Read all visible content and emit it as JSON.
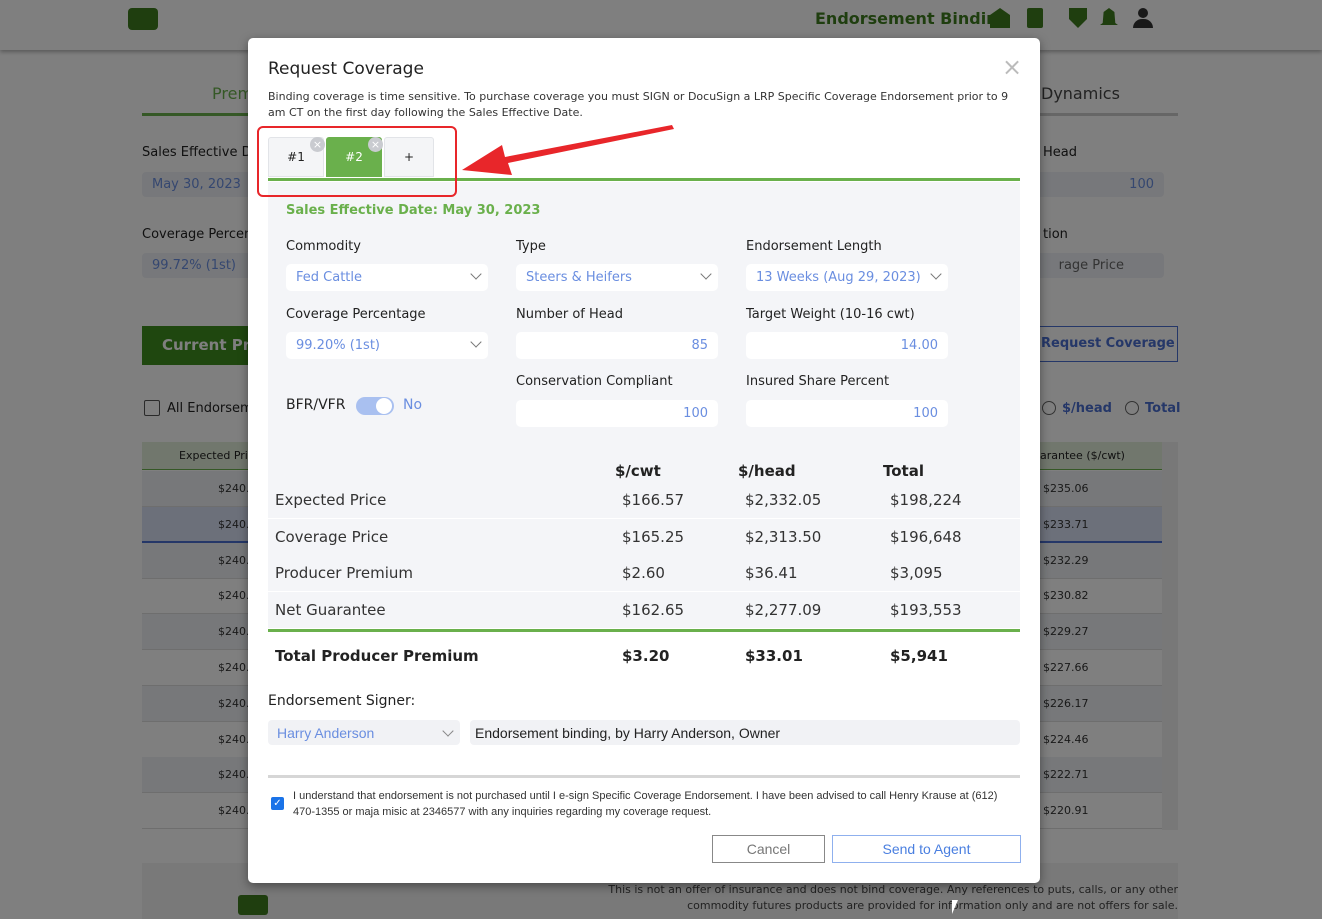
{
  "header": {
    "title": "Endorsement Binding",
    "icons": [
      "barn-icon",
      "book-icon",
      "shield-icon",
      "bell-icon",
      "user-icon"
    ]
  },
  "background": {
    "tabs": [
      "Prem",
      "Dynamics"
    ],
    "sales_effective_label": "Sales Effective D",
    "sales_effective_value": "May 30, 2023",
    "coverage_percent_label": "Coverage Percen",
    "coverage_percent_value": "99.72% (1st)",
    "head_label": "Head",
    "head_value": "100",
    "option_label": "tion",
    "option_value": "rage Price",
    "current_price_button": "Current Pric",
    "request_coverage_button": "Request Coverage",
    "all_endorsements_label": "All Endorsem",
    "radio_head": "$/head",
    "radio_total": "Total",
    "table_headers": [
      "Expected Pri",
      "arantee ($/cwt)"
    ],
    "rows_left": [
      "$240.",
      "$240.",
      "$240.",
      "$240.",
      "$240.",
      "$240.",
      "$240.",
      "$240.",
      "$240.",
      "$240."
    ],
    "rows_right": [
      "$235.06",
      "$233.71",
      "$232.29",
      "$230.82",
      "$229.27",
      "$227.66",
      "$226.17",
      "$224.46",
      "$222.71",
      "$220.91"
    ],
    "footer_line1": "This is not an offer of insurance and does not bind coverage. Any references to puts, calls, or any other",
    "footer_line2": "commodity futures products are provided for information only and are not offers for sale."
  },
  "modal": {
    "title": "Request Coverage",
    "close": "×",
    "description": "Binding coverage is time sensitive. To purchase coverage you must SIGN or DocuSign a LRP Specific Coverage Endorsement prior to 9 am CT on the first day following the Sales Effective Date.",
    "tabs": [
      {
        "label": "#1",
        "active": false
      },
      {
        "label": "#2",
        "active": true
      },
      {
        "label": "+"
      }
    ],
    "sales_effective": "Sales Effective Date: May 30, 2023",
    "fields": {
      "commodity": {
        "label": "Commodity",
        "value": "Fed Cattle"
      },
      "type": {
        "label": "Type",
        "value": "Steers & Heifers"
      },
      "length": {
        "label": "Endorsement Length",
        "value": "13 Weeks (Aug 29, 2023)"
      },
      "coverage": {
        "label": "Coverage Percentage",
        "value": "99.20% (1st)"
      },
      "head": {
        "label": "Number of Head",
        "value": "85"
      },
      "weight": {
        "label": "Target Weight (10-16 cwt)",
        "value": "14.00"
      },
      "bfr": {
        "label": "BFR/VFR",
        "value": "No"
      },
      "conservation": {
        "label": "Conservation Compliant",
        "value": "100"
      },
      "share": {
        "label": "Insured Share Percent",
        "value": "100"
      }
    },
    "results": {
      "headers": [
        "$/cwt",
        "$/head",
        "Total"
      ],
      "rows": [
        {
          "label": "Expected Price",
          "cwt": "$166.57",
          "head": "$2,332.05",
          "total": "$198,224"
        },
        {
          "label": "Coverage Price",
          "cwt": "$165.25",
          "head": "$2,313.50",
          "total": "$196,648"
        },
        {
          "label": "Producer Premium",
          "cwt": "$2.60",
          "head": "$36.41",
          "total": "$3,095"
        },
        {
          "label": "Net Guarantee",
          "cwt": "$162.65",
          "head": "$2,277.09",
          "total": "$193,553"
        }
      ],
      "total": {
        "label": "Total Producer Premium",
        "cwt": "$3.20",
        "head": "$33.01",
        "total": "$5,941"
      }
    },
    "signer_label": "Endorsement Signer:",
    "signer_value": "Harry Anderson",
    "signer_text": "Endorsement binding, by Harry Anderson, Owner",
    "acknowledge": "I understand that endorsement is not purchased until I e-sign Specific Coverage Endorsement. I have been advised to call Henry Krause at (612) 470-1355 or maja misic at 2346577 with any inquiries regarding my coverage request.",
    "acknowledged": true,
    "cancel": "Cancel",
    "send": "Send to Agent"
  },
  "colors": {
    "brand_green": "#6ab04c",
    "dark_green": "#3f7d1f",
    "link_blue": "#4a6fd0",
    "annotation_red": "#e8262a"
  }
}
